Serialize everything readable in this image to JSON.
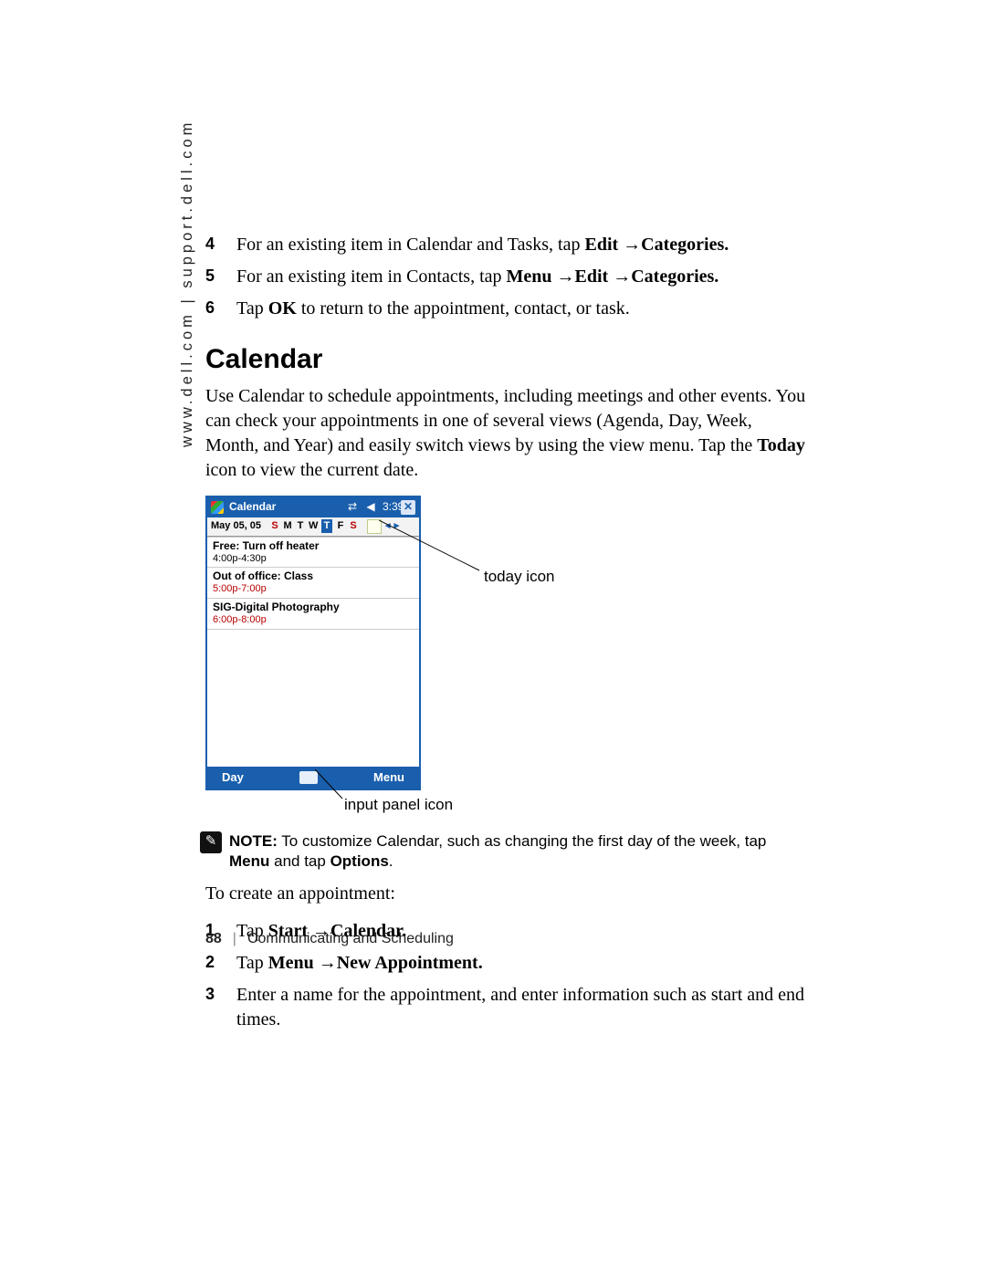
{
  "side_label": "www.dell.com | support.dell.com",
  "top_list": [
    {
      "num": "4",
      "prefix": "For an existing item in Calendar and Tasks, tap ",
      "bold": "Edit →Categories."
    },
    {
      "num": "5",
      "prefix": "For an existing item in Contacts, tap ",
      "bold": "Menu →Edit →Categories."
    },
    {
      "num": "6",
      "prefix": "Tap ",
      "bold": "OK",
      "suffix": " to return to the appointment, contact, or task."
    }
  ],
  "section_title": "Calendar",
  "intro_para": "Use Calendar to schedule appointments, including meetings and other events. You can check your appointments in one of several views (Agenda, Day, Week, Month, and Year) and easily switch views by using the view menu. Tap the ",
  "intro_bold": "Today",
  "intro_suffix": " icon to view the current date.",
  "device": {
    "title": "Calendar",
    "time": "3:39",
    "date": "May 05, 05",
    "dows": [
      "S",
      "M",
      "T",
      "W",
      "T",
      "F",
      "S"
    ],
    "active_dow_index": 4,
    "appts": [
      {
        "subj": "Free: Turn off heater",
        "time": "4:00p-4:30p",
        "time_color": "black"
      },
      {
        "subj": "Out of office: Class",
        "time": "5:00p-7:00p",
        "time_color": "red"
      },
      {
        "subj": "SIG-Digital Photography",
        "time": "6:00p-8:00p",
        "time_color": "red"
      }
    ],
    "left_soft": "Day",
    "right_soft": "Menu"
  },
  "callouts": {
    "today": "today icon",
    "input_panel": "input panel icon"
  },
  "note": {
    "label": "NOTE:",
    "body_pre": " To customize Calendar, such as changing the first day of the week, tap ",
    "b1": "Menu",
    "mid": " and tap ",
    "b2": "Options",
    "end": "."
  },
  "create_intro": "To create an appointment:",
  "create_list": [
    {
      "num": "1",
      "pre": "Tap  ",
      "bold": "Start →Calendar."
    },
    {
      "num": "2",
      "pre": "Tap ",
      "bold": "Menu →New Appointment."
    },
    {
      "num": "3",
      "pre": "Enter a name for the appointment, and enter information such as start and end times."
    }
  ],
  "footer": {
    "page": "88",
    "chapter": "Communicating and Scheduling"
  }
}
